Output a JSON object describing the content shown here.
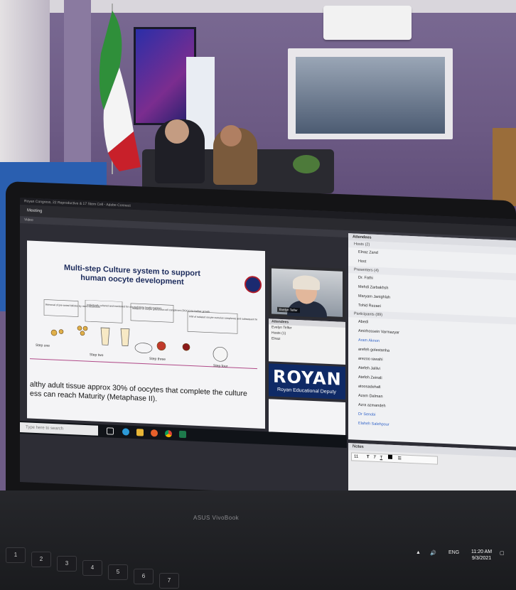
{
  "app": {
    "window_title": "Royan Congress, 22 Reproductive & 17 Stem Cell - Adobe Connect",
    "menu": [
      "Meeting"
    ],
    "video_label": "Video"
  },
  "slide": {
    "title_line1": "Multi-step Culture system to support",
    "title_line2": "human oocyte development",
    "steps": [
      "Step one",
      "Step two",
      "Step three",
      "Step four"
    ],
    "boxes": [
      "Removal of pre-antral follicles by micro-dissection",
      "Individually cultured and monitored for oocyte/follicle health markers",
      "Isolation of oocyte granulosa cell complexes (OGCs) for further growth",
      "IVM of isolated oocyte-cumulus complexes and subsequent fertilisation"
    ],
    "text_line1": "althy adult tissue approx 30% of oocytes that complete the culture",
    "text_line2": "ess can reach Maturity (Metaphase II)."
  },
  "video": {
    "presenter_name": "Evelyn Telfer",
    "attendees_header": "Attendees",
    "attendees": [
      "Evelyn Telfer",
      "Hosts (1)",
      "Elnaz"
    ]
  },
  "royan": {
    "logo": "ROYAN",
    "subtitle": "Royan Educational Deputy"
  },
  "attendees_pod": {
    "title": "Attendees",
    "hosts_label": "Hosts (2)",
    "hosts": [
      "Elnaz Zand",
      "Host"
    ],
    "presenters_label": "Presenters (4)",
    "presenters": [
      "Dr. Fathi",
      "Mehdi Zarbakhsh",
      "Maryam Janighlah",
      "Tohid Rezaei"
    ],
    "participants_label": "Participants (89)",
    "participants": [
      "Abedi",
      "Amirhossein Varmazyar",
      "Aram Aknon",
      "arefeh golestanha",
      "arezoo rawahi",
      "Atefeh Jalilvi",
      "Atefeh Zeinali",
      "atoosadehafi",
      "Azam Dalman",
      "Azra azmandeh",
      "Dr Senobi",
      "Elaheh Salehpour"
    ]
  },
  "notes": {
    "title": "Notes",
    "font_size": "11"
  },
  "taskbar": {
    "search_placeholder": "Type here to search"
  },
  "laptop": {
    "brand": "ASUS VivoBook",
    "lang": "ENG",
    "time": "11:20 AM",
    "date": "9/3/2021"
  },
  "keys": [
    "1",
    "2",
    "3",
    "4",
    "5",
    "6",
    "7"
  ]
}
